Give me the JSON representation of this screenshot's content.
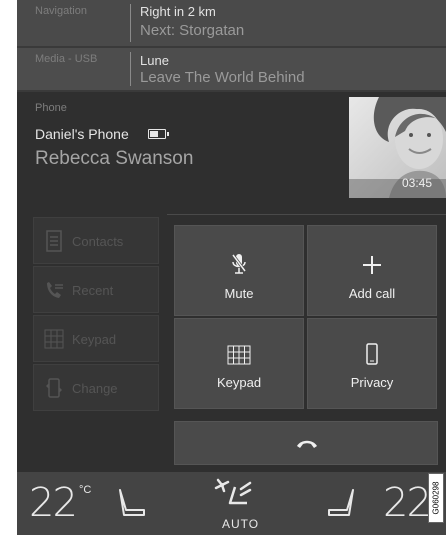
{
  "navigation": {
    "label": "Navigation",
    "line1": "Right in 2 km",
    "line2": "Next: Storgatan"
  },
  "media": {
    "label": "Media - USB",
    "line1": "Lune",
    "line2": "Leave The World Behind"
  },
  "phone": {
    "label": "Phone",
    "device": "Daniel's Phone",
    "contact": "Rebecca Swanson",
    "timer": "03:45"
  },
  "menu": [
    {
      "label": "Contacts",
      "icon": "contacts-icon"
    },
    {
      "label": "Recent",
      "icon": "recent-calls-icon"
    },
    {
      "label": "Keypad",
      "icon": "keypad-icon"
    },
    {
      "label": "Change",
      "icon": "change-phone-icon"
    }
  ],
  "buttons": {
    "mute": "Mute",
    "add_call": "Add call",
    "keypad": "Keypad",
    "privacy": "Privacy"
  },
  "climate": {
    "left_temp": "22",
    "unit": "°C",
    "right_temp": "22",
    "mode": "AUTO"
  },
  "image_code": "G060298",
  "colors": {
    "background": "#3a3a3a",
    "button": "#4a4a4a",
    "text": "#f0f0f0",
    "dim": "#555555"
  }
}
